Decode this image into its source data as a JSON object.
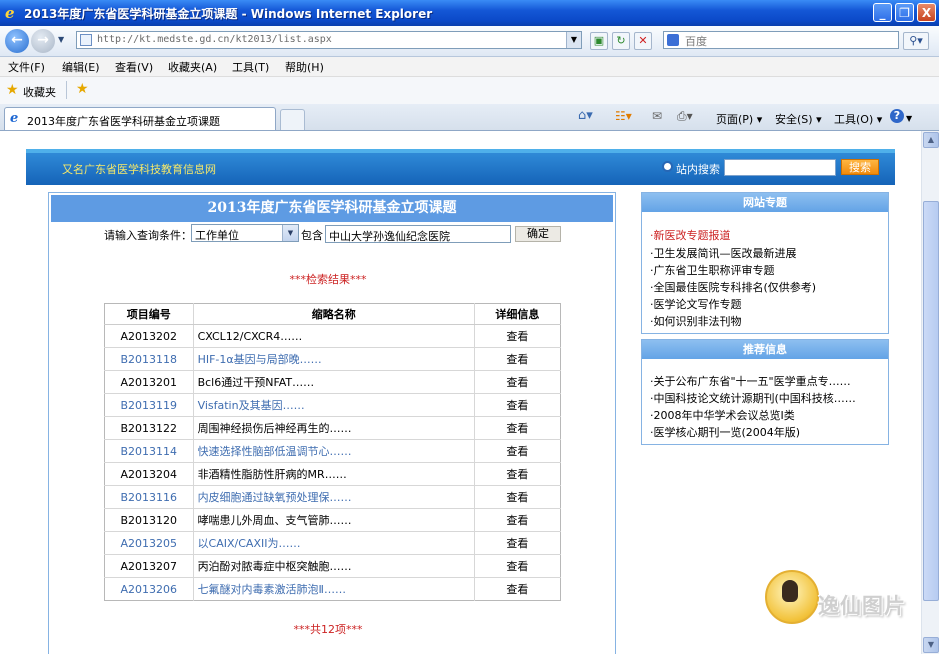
{
  "window": {
    "title": "2013年度广东省医学科研基金立项课题 - Windows Internet Explorer",
    "controls": [
      "_",
      "❐",
      "X"
    ]
  },
  "address": {
    "url": "http://kt.medste.gd.cn/kt2013/list.aspx",
    "search_placeholder": "百度"
  },
  "menu": [
    "文件(F)",
    "编辑(E)",
    "查看(V)",
    "收藏夹(A)",
    "工具(T)",
    "帮助(H)"
  ],
  "favorites": {
    "label": "收藏夹"
  },
  "tab": {
    "label": "2013年度广东省医学科研基金立项课题"
  },
  "commands": {
    "page": "页面(P)",
    "safety": "安全(S)",
    "tools": "工具(O)"
  },
  "banner": {
    "alt_text": "又名广东省医学科技教育信息网",
    "site_search_label": "站内搜索",
    "search_button": "搜索"
  },
  "main": {
    "title": "2013年度广东省医学科研基金立项课题",
    "query_label": "请输入查询条件：",
    "query_field": "工作单位",
    "contains_label": "包含",
    "query_value": "中山大学孙逸仙纪念医院",
    "confirm_button": "确定",
    "result_title": "***检索结果***",
    "columns": [
      "项目编号",
      "缩略名称",
      "详细信息"
    ],
    "rows": [
      {
        "id": "A2013202",
        "name": "CXCL12/CXCR4……",
        "detail": "查看"
      },
      {
        "id": "B2013118",
        "name": "HIF-1α基因与局部晚……",
        "detail": "查看"
      },
      {
        "id": "A2013201",
        "name": "Bcl6通过干预NFAT……",
        "detail": "查看"
      },
      {
        "id": "B2013119",
        "name": "Visfatin及其基因……",
        "detail": "查看"
      },
      {
        "id": "B2013122",
        "name": "周围神经损伤后神经再生的……",
        "detail": "查看"
      },
      {
        "id": "B2013114",
        "name": "快速选择性脑部低温调节心……",
        "detail": "查看"
      },
      {
        "id": "A2013204",
        "name": "非酒精性脂肪性肝病的MR……",
        "detail": "查看"
      },
      {
        "id": "B2013116",
        "name": "内皮细胞通过缺氧预处理保……",
        "detail": "查看"
      },
      {
        "id": "B2013120",
        "name": "哮喘患儿外周血、支气管肺……",
        "detail": "查看"
      },
      {
        "id": "A2013205",
        "name": "以CAIX/CAXII为……",
        "detail": "查看"
      },
      {
        "id": "A2013207",
        "name": "丙泊酚对脓毒症中枢突触胞……",
        "detail": "查看"
      },
      {
        "id": "A2013206",
        "name": "七氟醚对内毒素激活肺泡Ⅱ……",
        "detail": "查看"
      }
    ],
    "total": "***共12项***"
  },
  "sidebar": {
    "topics_title": "网站专题",
    "topics": [
      "·新医改专题报道",
      "·卫生发展简讯—医改最新进展",
      "·广东省卫生职称评审专题",
      "·全国最佳医院专科排名(仅供参考)",
      "·医学论文写作专题",
      "·如何识别非法刊物"
    ],
    "recommend_title": "推荐信息",
    "recommend": [
      "·关于公布广东省\"十一五\"医学重点专……",
      "·中国科技论文统计源期刊(中国科技核……",
      "·2008年中华学术会议总览Ⅰ类",
      "·医学核心期刊一览(2004年版)"
    ]
  },
  "watermark": {
    "text": "逸仙图片"
  }
}
